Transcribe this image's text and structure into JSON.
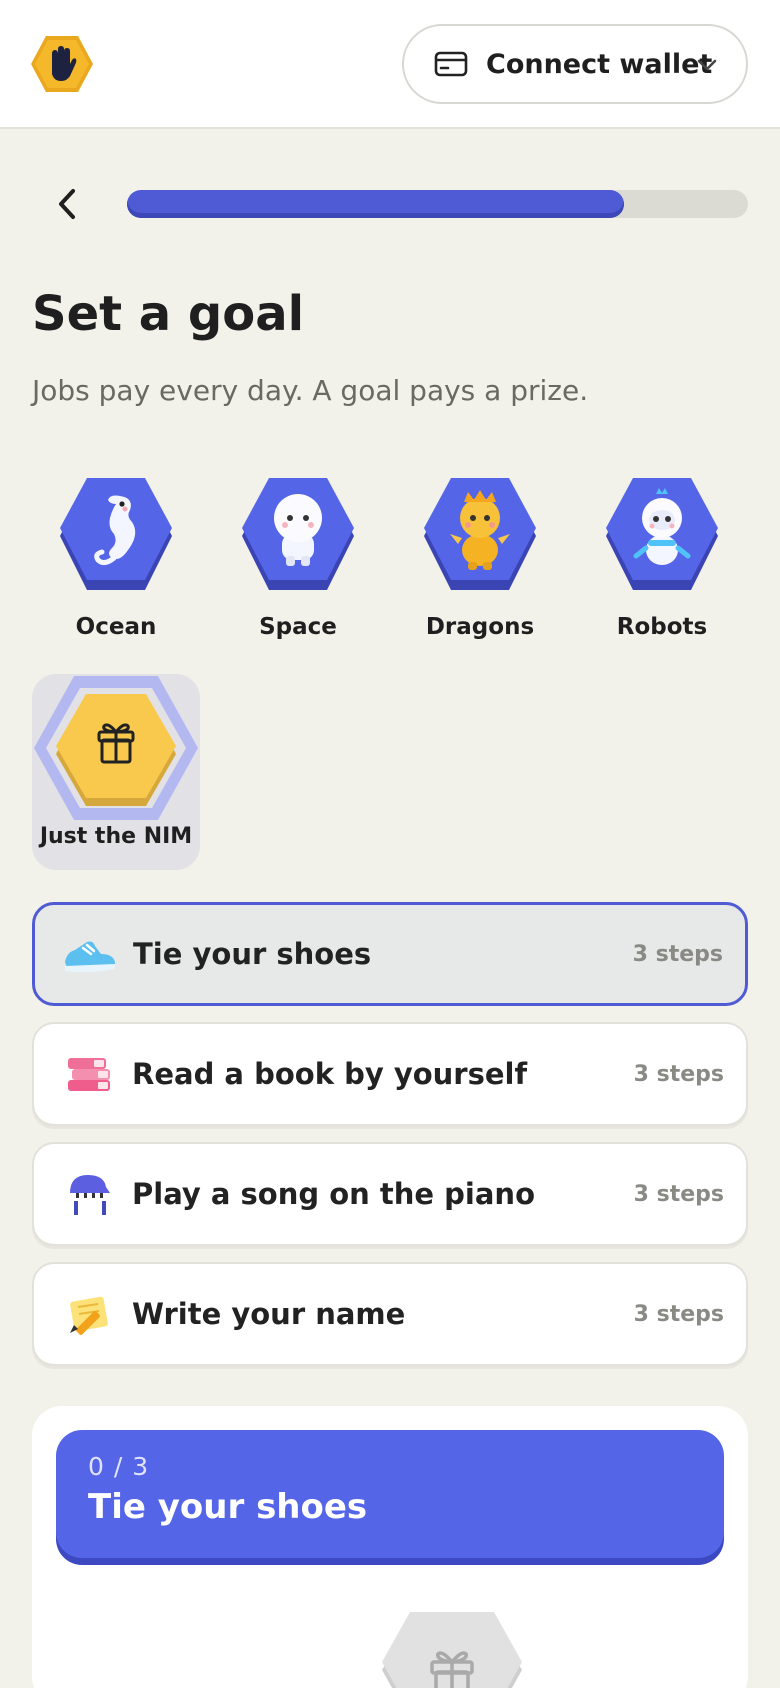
{
  "header": {
    "logo_icon": "raised-hand-hexagon-icon",
    "wallet_label": "Connect wallet",
    "wallet_icon": "card-icon",
    "dropdown_icon": "chevron-down-icon"
  },
  "progress": {
    "value": 0.8,
    "color": "#4f5bd5"
  },
  "page": {
    "title": "Set a goal",
    "subtitle": "Jobs pay every day. A goal pays a prize."
  },
  "themes": [
    {
      "label": "Ocean",
      "icon": "seahorse-icon"
    },
    {
      "label": "Space",
      "icon": "astronaut-icon"
    },
    {
      "label": "Dragons",
      "icon": "dragon-icon"
    },
    {
      "label": "Robots",
      "icon": "robot-icon"
    }
  ],
  "nim_option": {
    "label": "Just the NIM",
    "icon": "gift-icon",
    "selected": true
  },
  "goals": [
    {
      "label": "Tie your shoes",
      "steps": "3 steps",
      "icon": "sneaker-icon",
      "selected": true
    },
    {
      "label": "Read a book by yourself",
      "steps": "3 steps",
      "icon": "books-icon",
      "selected": false
    },
    {
      "label": "Play a song on the piano",
      "steps": "3 steps",
      "icon": "piano-icon",
      "selected": false
    },
    {
      "label": "Write your name",
      "steps": "3 steps",
      "icon": "memo-pencil-icon",
      "selected": false
    }
  ],
  "current_goal": {
    "count": "0 / 3",
    "name": "Tie your shoes",
    "reward_icon": "gift-icon"
  },
  "colors": {
    "accent": "#4f5bd5",
    "background": "#f3f2ea",
    "gold": "#f8c94d"
  }
}
